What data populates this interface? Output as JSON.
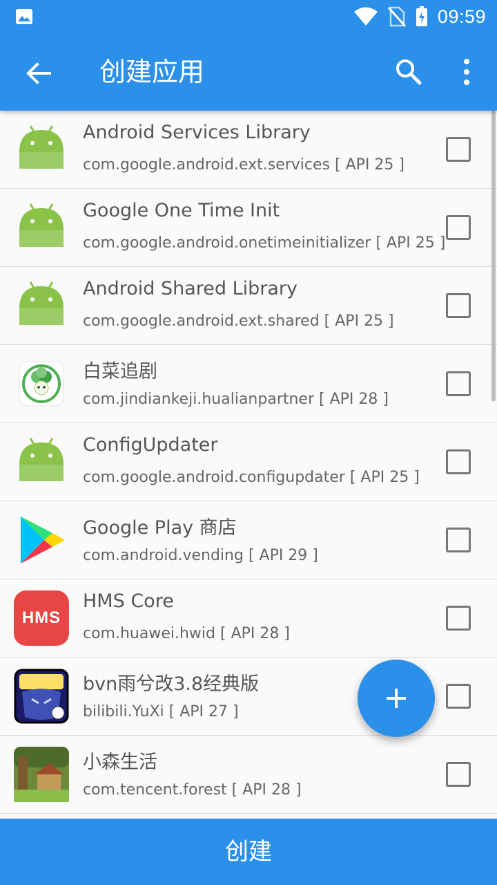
{
  "status_bar": {
    "time": "09:59"
  },
  "app_bar": {
    "title": "创建应用"
  },
  "apps": [
    {
      "name": "Android Services Library",
      "package": "com.google.android.ext.services [ API 25 ]",
      "icon": "android-robot-icon"
    },
    {
      "name": "Google One Time Init",
      "package": "com.google.android.onetimeinitializer [ API 25 ]",
      "icon": "android-robot-icon"
    },
    {
      "name": "Android Shared Library",
      "package": "com.google.android.ext.shared [ API 25 ]",
      "icon": "android-robot-icon"
    },
    {
      "name": "白菜追剧",
      "package": "com.jindiankeji.hualianpartner [ API 28 ]",
      "icon": "cabbage-mascot-icon"
    },
    {
      "name": "ConfigUpdater",
      "package": "com.google.android.configupdater [ API 25 ]",
      "icon": "android-robot-icon"
    },
    {
      "name": "Google Play 商店",
      "package": "com.android.vending [ API 29 ]",
      "icon": "google-play-icon"
    },
    {
      "name": "HMS Core",
      "package": "com.huawei.hwid [ API 28 ]",
      "icon": "hms-core-icon",
      "icon_text": "HMS"
    },
    {
      "name": "bvn雨兮改3.8经典版",
      "package": "bilibili.YuXi [ API 27 ]",
      "icon": "bvn-game-icon"
    },
    {
      "name": "小森生活",
      "package": "com.tencent.forest [ API 28 ]",
      "icon": "forest-game-icon"
    }
  ],
  "bottom_button": {
    "label": "创建"
  },
  "colors": {
    "primary": "#2b90e9",
    "android_green": "#8bc34a",
    "hms_red": "#e84545"
  }
}
